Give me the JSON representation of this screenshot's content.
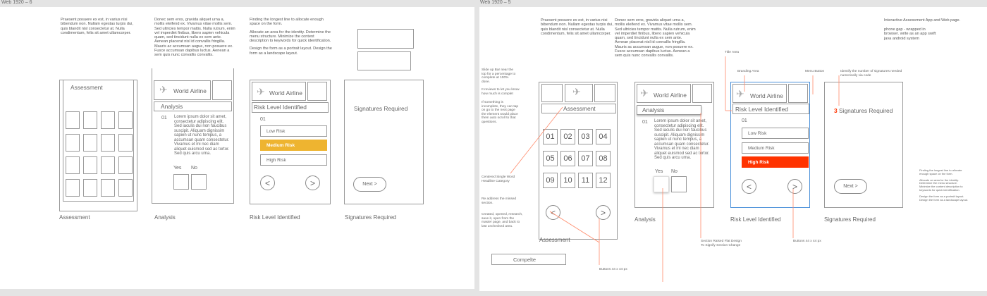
{
  "colors": {
    "accent_yellow": "#eeb430",
    "accent_red": "#ff3300",
    "annotation_line": "#ff8a6a"
  },
  "artboard1": {
    "title": "Web 1920 – 6",
    "note1": "Praesent posuere ex est, in varius nisi bibendum non. Nullam egestas turpis dui, quis blandit nisl consectetur at. Nulla condimentum, felis sit amet ullamcorper.",
    "note2": "Donec sem eros, gravida aliquet urna a, mollis eleifend ex. Vivamus vitae mollis sem. Sed ultricies tempor mattis. Nulla rutrum, enim vel imperdiet finibus, libero sapien vehicula quam, sed tincidunt nulla ex sem ante. Aenean placerat nisl id convallis fringilla. Mauris ac accumsan augue, non posuere ex. Fusce accumsan dapibus luctus. Aenean a sem quis nunc convallis convallis.",
    "note3": [
      "Finding the longest line to allocate enough space on the form.",
      "Allocate an area for the identity. Determine the menu structure. Minimize the content description to keywords for quick identification.",
      "Design the form as a portrait layout. Design the form as a landscape layout."
    ],
    "s1": {
      "header": "Assessment",
      "caption": "Assessment"
    },
    "s2": {
      "brand": "World Airline",
      "section": "Analysis",
      "q_no": "01",
      "q_text": "Lorem ipsum dolor sit amet, consectetur adipiscing elit. Sed iaculis dui non faucibus suscipit. Aliquam dignissim sapien ut nunc tempus, a accumsan quam consectetur. Vivamus et mi nec diam aliquet euismod sed ac tortor. Sed quis arcu urna.",
      "yes": "Yes",
      "no": "No",
      "caption": "Analysis"
    },
    "s3": {
      "brand": "World Airline",
      "section": "Risk Level Identified",
      "q_no": "01",
      "low": "Low Risk",
      "medium": "Medium Risk",
      "high": "High Risk",
      "prev": "<",
      "next": ">",
      "caption": "Risk Level Identified"
    },
    "s4": {
      "title": "Signatures Required",
      "next": "Next >",
      "caption": "Signatures Required"
    }
  },
  "artboard2": {
    "title": "Web 1920 – 5",
    "note1": "Praesent posuere ex est, in varius nisi bibendum non. Nullam egestas turpis dui, quis blandit nisl consectetur at. Nulla condimentum, felis sit amet ullamcorper.",
    "note2": "Donec sem eros, gravida aliquet urna a, mollis eleifend ex. Vivamus vitae mollis sem. Sed ultricies tempor mattis. Nulla rutrum, enim vel imperdiet finibus, libero sapien vehicula quam, sed tincidunt nulla ex sem ante. Aenean placerat nisl id convallis fringilla. Mauris ac accumsan augue, non posuere ex. Fusce accumsan dapibus luctus. Aenean a sem quis nunc convallis convallis.",
    "note3": "Interactive Assessment App and Web page.",
    "note4": "phone gap - wrapped in browser. write as an app swift java android system",
    "left_ann1": "Slide up Bar near the top for a percentage to complete at 100% done.",
    "left_ann2": "It reviews to let you know how much is complet",
    "left_ann3": "If something is incomplete, they can tap on go to the next page the element would place them auto scroll to that questions.",
    "left_ann4": "Centered Single Word Headline Category",
    "left_ann5": "Re address the missed section.",
    "left_ann6": "Created, opened, research, save it, open from the master page, and back to last unchecked area.",
    "s1": {
      "header": "Assessment",
      "numbers": [
        "01",
        "02",
        "03",
        "04",
        "05",
        "06",
        "07",
        "08",
        "09",
        "10",
        "11",
        "12"
      ],
      "prev": "<",
      "next": ">",
      "caption": "Assessment"
    },
    "complete": "Compelte",
    "buttons_ann1": "Buttons 44 x 44 px",
    "s2": {
      "brand": "World Airline",
      "section": "Analysis",
      "q_no": "01",
      "q_text": "Lorem ipsum dolor sit amet, consectetur adipiscing elit. Sed iaculis dui non faucibus suscipit. Aliquam dignissim sapien ut nunc tempus, a accumsan quam consectetur. Vivamus et mi nec diam aliquet euismod sed ac tortor. Sed quis arcu urna.",
      "yes": "Yes",
      "no": "No",
      "caption": "Analysis"
    },
    "section_ann": "Section Raised Flat Design To Signify Section Change",
    "title_area": "Title Area",
    "branding_area": "Branding Area",
    "menu_button": "Menu Button",
    "s3": {
      "brand": "World Airline",
      "section": "Risk Level Identified",
      "q_no": "01",
      "low": "Low Risk",
      "medium": "Medium Risk",
      "high": "High Risk",
      "prev": "<",
      "next": ">",
      "caption": "Risk Level Identified"
    },
    "buttons_ann2": "Buttons 44 x 44 px",
    "sig_ann": "Identify the number of signatures needed numerically via code",
    "s4": {
      "count": "3",
      "title": "Signatures Required",
      "next": "Next >",
      "caption": "Signatures Required"
    },
    "right_note": [
      "Finding the longest line to allocate enough space on the form.",
      "Allocate an area for the identity. Determine the menu structure. Minimize the content description to keywords for quick identification.",
      "Design the form as a portrait layout. Design the form as a landscape layout."
    ]
  }
}
